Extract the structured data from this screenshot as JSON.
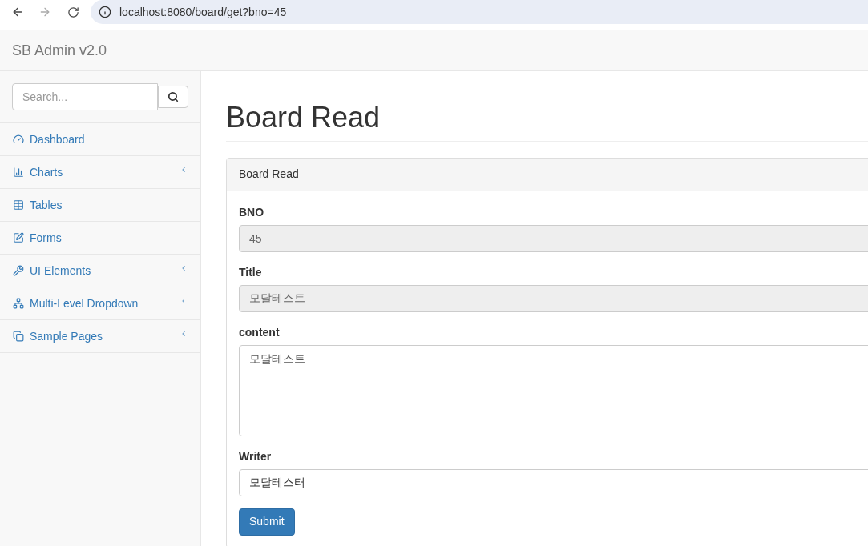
{
  "browser": {
    "url": "localhost:8080/board/get?bno=45"
  },
  "navbar": {
    "brand": "SB Admin v2.0"
  },
  "sidebar": {
    "search": {
      "placeholder": "Search..."
    },
    "items": [
      {
        "label": "Dashboard",
        "has_submenu": false
      },
      {
        "label": "Charts",
        "has_submenu": true
      },
      {
        "label": "Tables",
        "has_submenu": false
      },
      {
        "label": "Forms",
        "has_submenu": false
      },
      {
        "label": "UI Elements",
        "has_submenu": true
      },
      {
        "label": "Multi-Level Dropdown",
        "has_submenu": true
      },
      {
        "label": "Sample Pages",
        "has_submenu": true
      }
    ]
  },
  "page": {
    "heading": "Board Read",
    "panel": {
      "title": "Board Read",
      "fields": [
        {
          "label": "BNO",
          "kind": "input",
          "value": "45",
          "readonly": true
        },
        {
          "label": "Title",
          "kind": "input",
          "value": "모달테스트",
          "readonly": true
        },
        {
          "label": "content",
          "kind": "textarea",
          "value": "모달테스트",
          "readonly": false
        },
        {
          "label": "Writer",
          "kind": "input",
          "value": "모달테스터",
          "readonly": false
        }
      ],
      "button": "Submit"
    }
  }
}
